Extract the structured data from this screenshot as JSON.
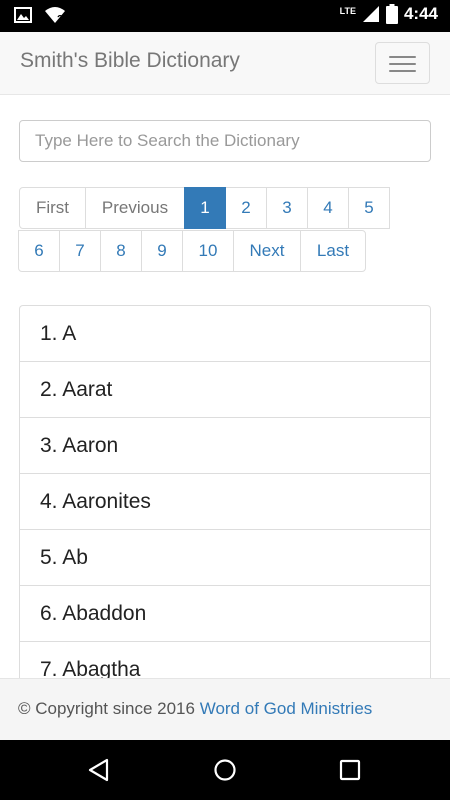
{
  "status": {
    "network_label": "LTE",
    "time": "4:44",
    "icons": [
      "image-icon",
      "wifi-question-icon",
      "signal-icon",
      "battery-icon"
    ]
  },
  "navbar": {
    "brand": "Smith's Bible Dictionary",
    "toggle_icon": "hamburger-menu-icon"
  },
  "search": {
    "placeholder": "Type Here to Search the Dictionary",
    "value": ""
  },
  "pagination": {
    "first": "First",
    "previous": "Previous",
    "pages": [
      "1",
      "2",
      "3",
      "4",
      "5",
      "6",
      "7",
      "8",
      "9",
      "10"
    ],
    "next": "Next",
    "last": "Last",
    "active_page": "1"
  },
  "entries": [
    "1. A",
    "2. Aarat",
    "3. Aaron",
    "4. Aaronites",
    "5. Ab",
    "6. Abaddon",
    "7. Abagtha"
  ],
  "footer": {
    "copyright": "© Copyright since 2016",
    "link": "Word of God Ministries"
  },
  "colors": {
    "link": "#337ab7",
    "active_page_bg": "#337ab7",
    "navbar_bg": "#f8f8f8",
    "footer_bg": "#f5f5f5"
  },
  "system_nav": {
    "icons": [
      "back-icon",
      "home-icon",
      "recents-icon"
    ]
  }
}
